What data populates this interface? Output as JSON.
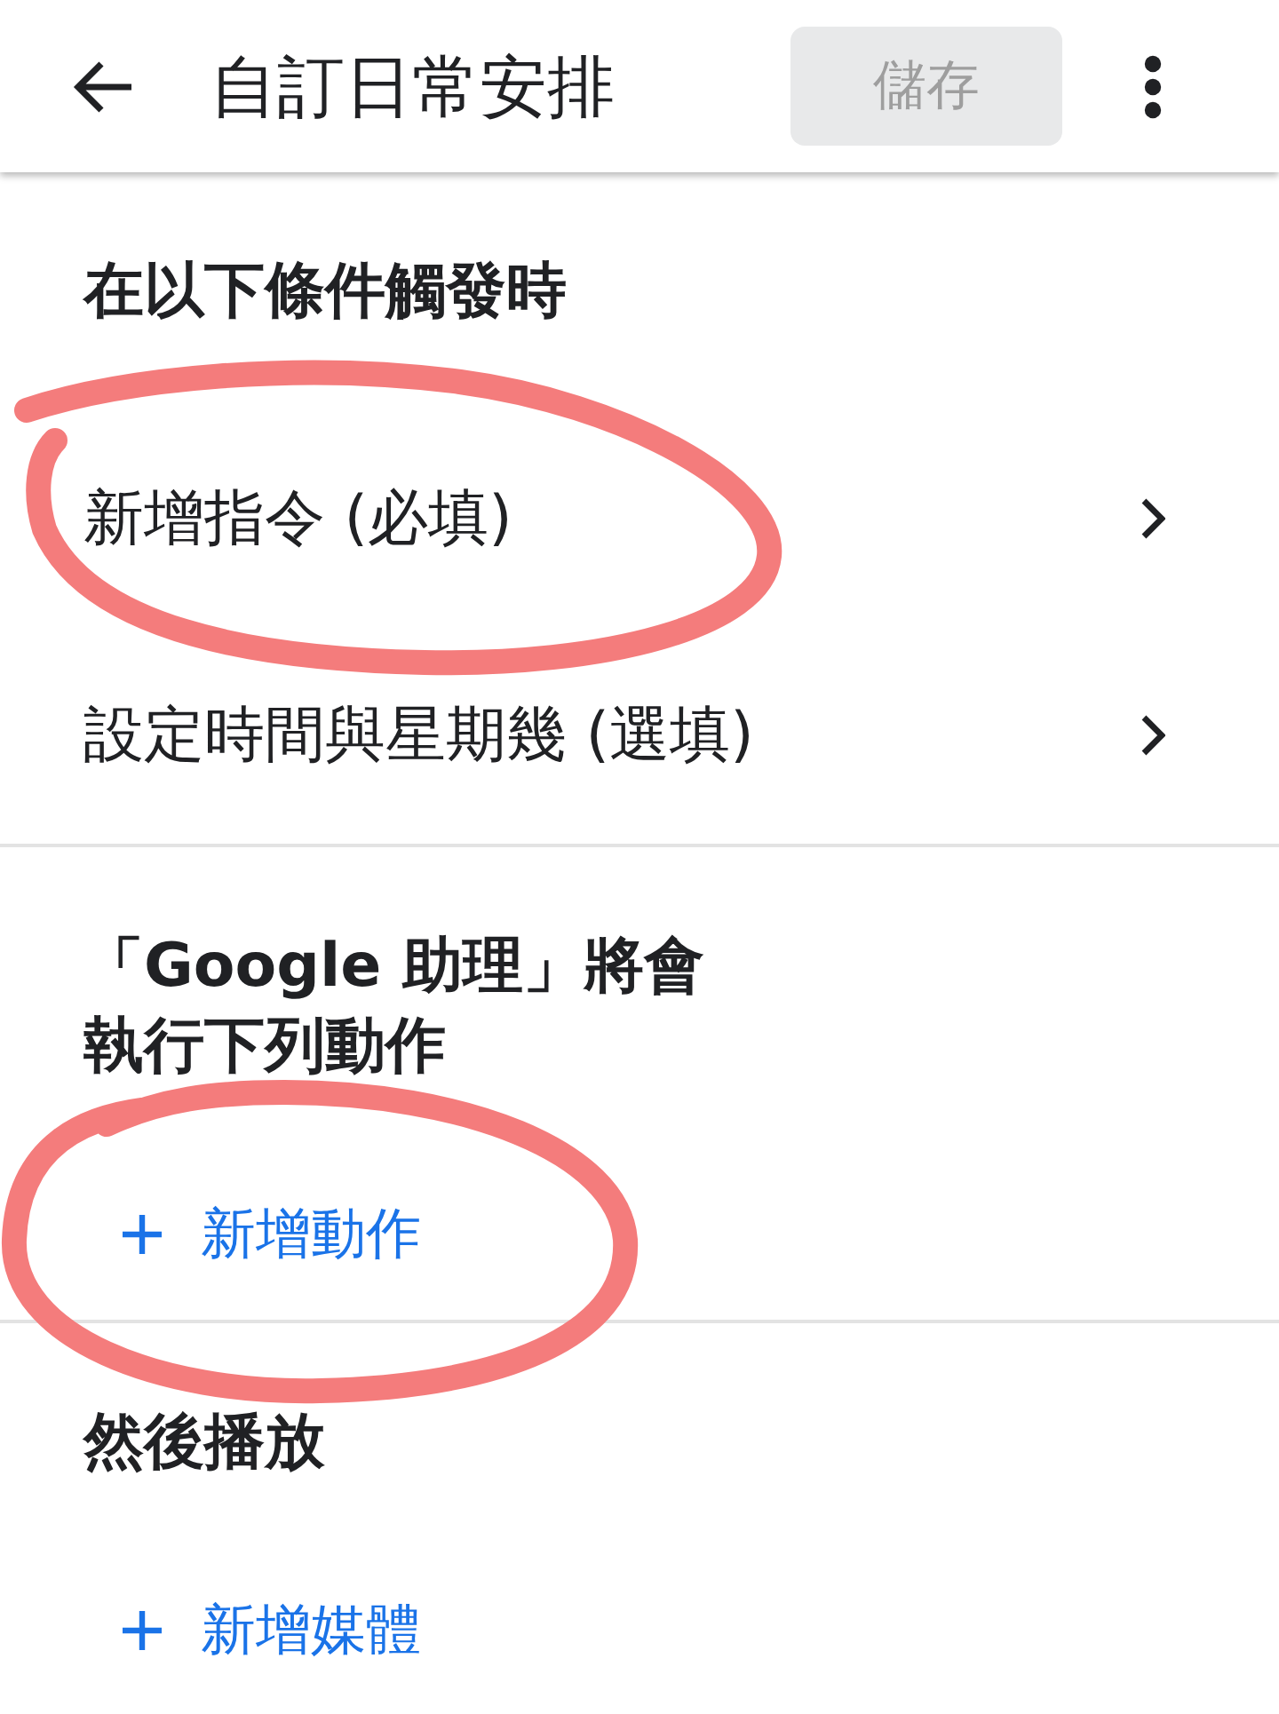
{
  "app_bar": {
    "title": "自訂日常安排",
    "save_button": {
      "label": "儲存",
      "disabled": true
    }
  },
  "sections": [
    {
      "title": "在以下條件觸發時",
      "rows": [
        {
          "kind": "nav",
          "label": "新增指令 (必填)",
          "circled": true
        },
        {
          "kind": "nav",
          "label": "設定時間與星期幾 (選填)",
          "circled": false
        }
      ]
    },
    {
      "title": "「Google 助理」將會執行下列動作",
      "rows": [
        {
          "kind": "add",
          "label": "新增動作",
          "circled": true
        }
      ]
    },
    {
      "title": "然後播放",
      "rows": [
        {
          "kind": "add",
          "label": "新增媒體",
          "circled": false
        }
      ]
    }
  ]
}
